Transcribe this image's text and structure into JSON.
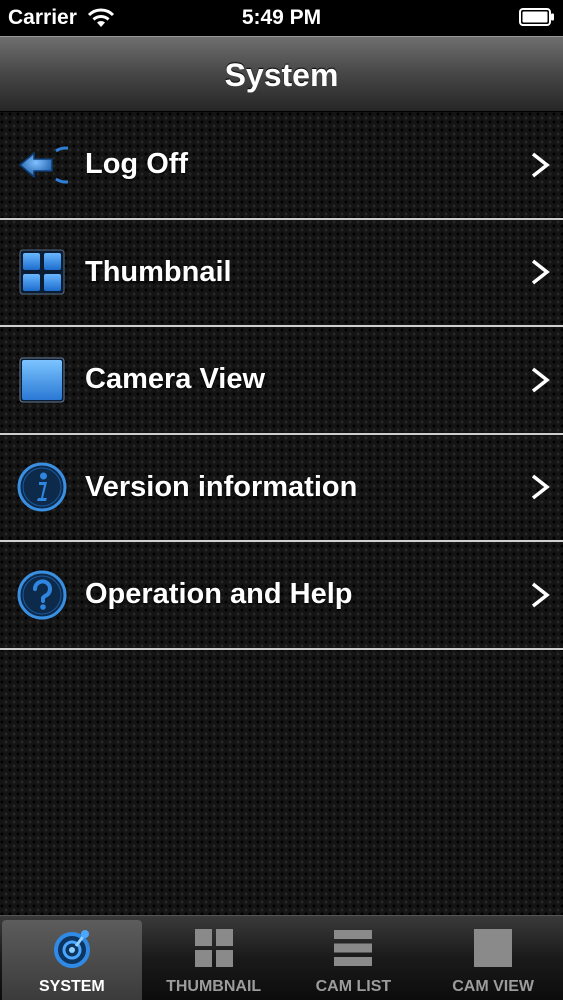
{
  "status_bar": {
    "carrier": "Carrier",
    "time": "5:49 PM"
  },
  "nav_bar": {
    "title": "System"
  },
  "menu": {
    "items": [
      {
        "label": "Log Off",
        "icon": "log-off-icon"
      },
      {
        "label": "Thumbnail",
        "icon": "thumbnail-grid-icon"
      },
      {
        "label": "Camera View",
        "icon": "camera-view-icon"
      },
      {
        "label": "Version information",
        "icon": "info-icon"
      },
      {
        "label": "Operation and Help",
        "icon": "help-icon"
      }
    ]
  },
  "tab_bar": {
    "active_index": 0,
    "tabs": [
      {
        "label": "SYSTEM",
        "icon": "system-icon"
      },
      {
        "label": "THUMBNAIL",
        "icon": "thumbnail-icon"
      },
      {
        "label": "CAM LIST",
        "icon": "cam-list-icon"
      },
      {
        "label": "CAM VIEW",
        "icon": "cam-view-icon"
      }
    ]
  },
  "colors": {
    "accent_blue": "#3a8fe0",
    "divider": "#cfcfcf",
    "tab_inactive_text": "#9c9c9c"
  }
}
